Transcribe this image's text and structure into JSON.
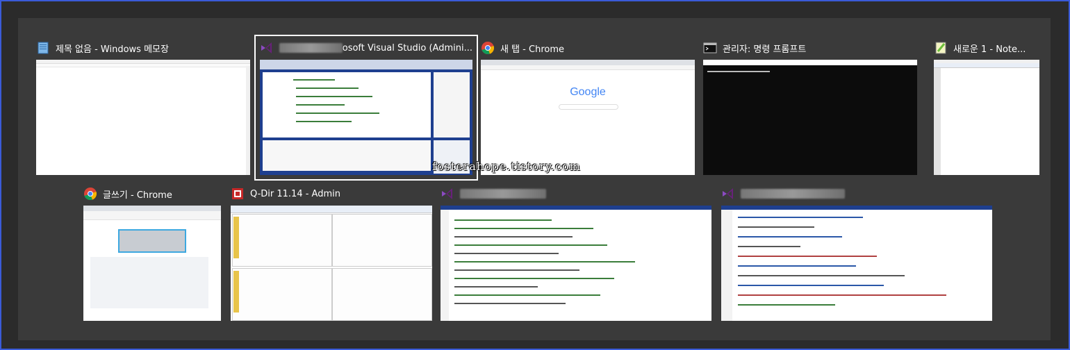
{
  "windows": [
    {
      "title": "제목 없음 - Windows 메모장",
      "icon": "notepad-icon"
    },
    {
      "title": "osoft Visual Studio (Admini...",
      "icon": "visual-studio-icon",
      "selected": true
    },
    {
      "title": "새 탭 - Chrome",
      "icon": "chrome-icon"
    },
    {
      "title": "관리자: 명령 프롬프트",
      "icon": "command-prompt-icon"
    },
    {
      "title": "새로운 1 - Note...",
      "icon": "notepad-plus-plus-icon"
    },
    {
      "title": "글쓰기 - Chrome",
      "icon": "chrome-icon"
    },
    {
      "title": "Q-Dir 11.14 - Admin",
      "icon": "q-dir-icon"
    },
    {
      "title": "",
      "icon": "visual-studio-icon"
    },
    {
      "title": "",
      "icon": "visual-studio-icon"
    }
  ],
  "chrome_thumb": {
    "logo": "Google"
  },
  "watermark": "fosterahope.tistory.com",
  "colors": {
    "accent": "#3a5bd8",
    "panel": "#3a3a3a",
    "vs_purple": "#68217a",
    "vs_blue": "#1e3f8f"
  }
}
